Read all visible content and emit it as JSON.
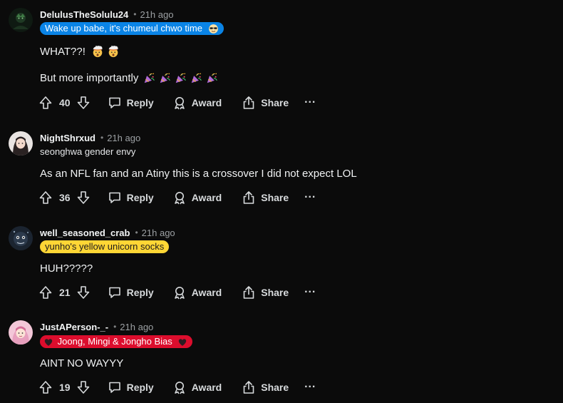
{
  "comments": [
    {
      "username": "DelulusTheSolulu24",
      "dot": "•",
      "time": "21h ago",
      "flair": "Wake up babe, it's chumeul chwo time",
      "flair_color": "#0a84e6",
      "body_lines": [
        "WHAT??!",
        "But more importantly"
      ],
      "votes": "40",
      "reply": "Reply",
      "award": "Award",
      "share": "Share",
      "more": "···"
    },
    {
      "username": "NightShrxud",
      "dot": "•",
      "time": "21h ago",
      "flair": "seonghwa gender envy",
      "flair_color": "",
      "body_lines": [
        "As an NFL fan and an Atiny this is a crossover I did not expect LOL"
      ],
      "votes": "36",
      "reply": "Reply",
      "award": "Award",
      "share": "Share",
      "more": "···"
    },
    {
      "username": "well_seasoned_crab",
      "dot": "•",
      "time": "21h ago",
      "flair": "yunho's yellow unicorn socks",
      "flair_color": "#ffd635",
      "body_lines": [
        "HUH?????"
      ],
      "votes": "21",
      "reply": "Reply",
      "award": "Award",
      "share": "Share",
      "more": "···"
    },
    {
      "username": "JustAPerson-_-",
      "dot": "•",
      "time": "21h ago",
      "flair": "Joong, Mingi & Jongho Bias",
      "flair_color": "#dc0d2d",
      "body_lines": [
        "AINT NO WAYYY"
      ],
      "votes": "19",
      "reply": "Reply",
      "award": "Award",
      "share": "Share",
      "more": "···"
    }
  ],
  "icons": {
    "upvote": "upvote-arrow-icon",
    "downvote": "downvote-arrow-icon",
    "reply": "speech-bubble-icon",
    "award": "award-ribbon-icon",
    "share": "share-upload-icon",
    "flair_emoji_1": "sunglasses-emoji-icon",
    "body_emoji_1": "exploding-head-emoji-icon",
    "body_emoji_2": "party-popper-emoji-icon",
    "flair_heart": "black-heart-emoji-icon"
  }
}
